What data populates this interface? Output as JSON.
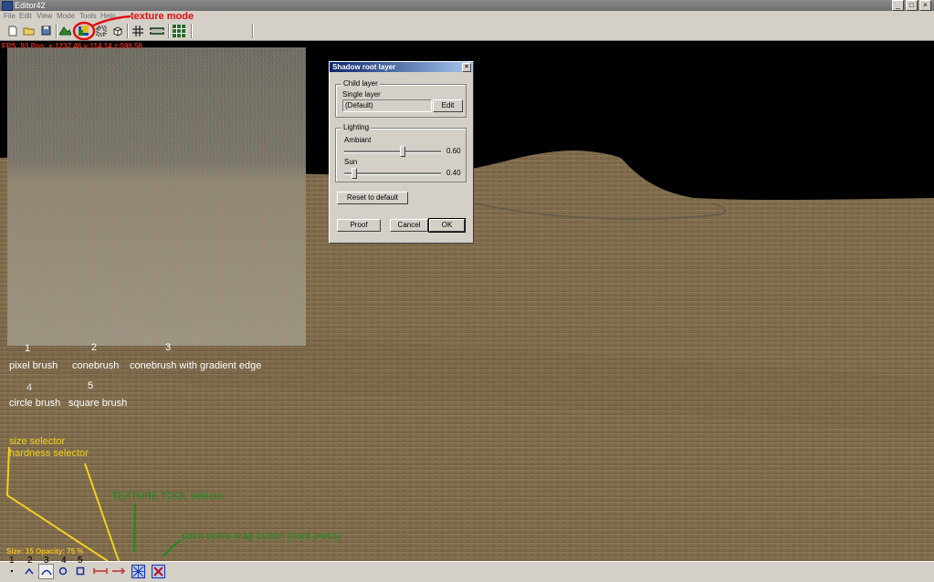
{
  "window": {
    "title": "Editor42",
    "min": "_",
    "max": "□",
    "close": "×"
  },
  "menu": [
    "File",
    "Edit",
    "View",
    "Mode",
    "Tools",
    "Help"
  ],
  "viewport": {
    "status": "FPS: 93   Pos: x:1237.46  y:114.14  z:598.58",
    "brush_numbers": [
      "1",
      "2",
      "3",
      "4",
      "5"
    ],
    "brush_labels": [
      "pixel brush",
      "conebrush",
      "conebrush with gradient edge",
      "circle brush",
      "square brush"
    ],
    "size_opacity": "Size: 15   Opacity: 75 %"
  },
  "annotations": {
    "texture_mode": "texture mode",
    "size_selector": "size selector",
    "hardness_selector": "hardness selector",
    "texture_tool": "TEXTURE TOOL selector",
    "paint_entire": "paint entire map button (dont press)"
  },
  "dialog": {
    "title": "Shadow root layer",
    "child_group": "Child layer",
    "single_layer": "Single layer",
    "layer_value": "(Default)",
    "edit": "Edit",
    "lighting_group": "Lighting",
    "ambient": "Ambiant",
    "ambient_value": "0.60",
    "ambient_level": 0.6,
    "sun": "Sun",
    "sun_value": "0.40",
    "sun_level": 0.1,
    "reset": "Reset to default",
    "proof": "Proof",
    "cancel": "Cancel",
    "ok": "OK"
  },
  "bottombar": {
    "numbers": [
      "1",
      "2",
      "3",
      "4",
      "5"
    ]
  },
  "colors": {
    "titlebar": "#7a7a7a",
    "chrome": "#d4d0c8",
    "dialog_title": "#0a246a",
    "annotation_red": "#e01010",
    "annotation_yellow": "#f0d020",
    "annotation_green": "#1c8a1c"
  }
}
